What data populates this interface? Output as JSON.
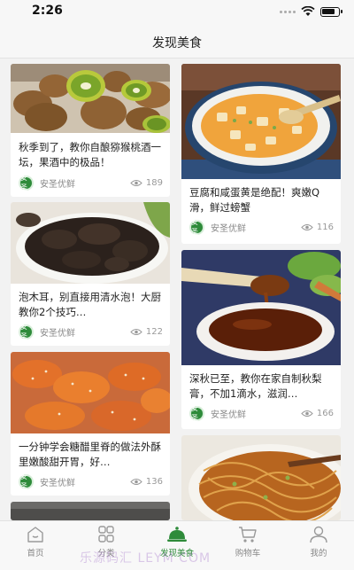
{
  "status": {
    "time": "2:26"
  },
  "header": {
    "title": "发现美食"
  },
  "cards": [
    {
      "title": "秋季到了，教你自酿猕猴桃酒一坛，果酒中的极品！",
      "author": "安圣优鲜",
      "views": "189",
      "image": "kiwi-fruit"
    },
    {
      "title": "泡木耳，别直接用清水泡！大厨教你2个技巧…",
      "author": "安圣优鲜",
      "views": "122",
      "image": "black-fungus"
    },
    {
      "title": "一分钟学会糖醋里脊的做法外酥里嫩酸甜开胃，好…",
      "author": "安圣优鲜",
      "views": "136",
      "image": "sweet-sour-pork"
    },
    {
      "title": "豆腐和咸蛋黄是绝配！爽嫩Q滑，鲜过螃蟹",
      "author": "安圣优鲜",
      "views": "116",
      "image": "tofu-egg-yolk"
    },
    {
      "title": "深秋已至，教你在家自制秋梨膏，不加1滴水，滋润…",
      "author": "安圣优鲜",
      "views": "166",
      "image": "pear-syrup"
    }
  ],
  "logo_text": "安圣",
  "tabs": [
    {
      "label": "首页",
      "icon": "home-icon"
    },
    {
      "label": "分类",
      "icon": "grid-icon"
    },
    {
      "label": "发现美食",
      "icon": "dish-cover-icon"
    },
    {
      "label": "购物车",
      "icon": "cart-icon"
    },
    {
      "label": "我的",
      "icon": "user-icon"
    }
  ],
  "active_tab": "发现美食",
  "watermark": "乐源码汇 LEYM COM",
  "colors": {
    "accent": "#2e8b3a",
    "background": "#f2f2f2"
  }
}
